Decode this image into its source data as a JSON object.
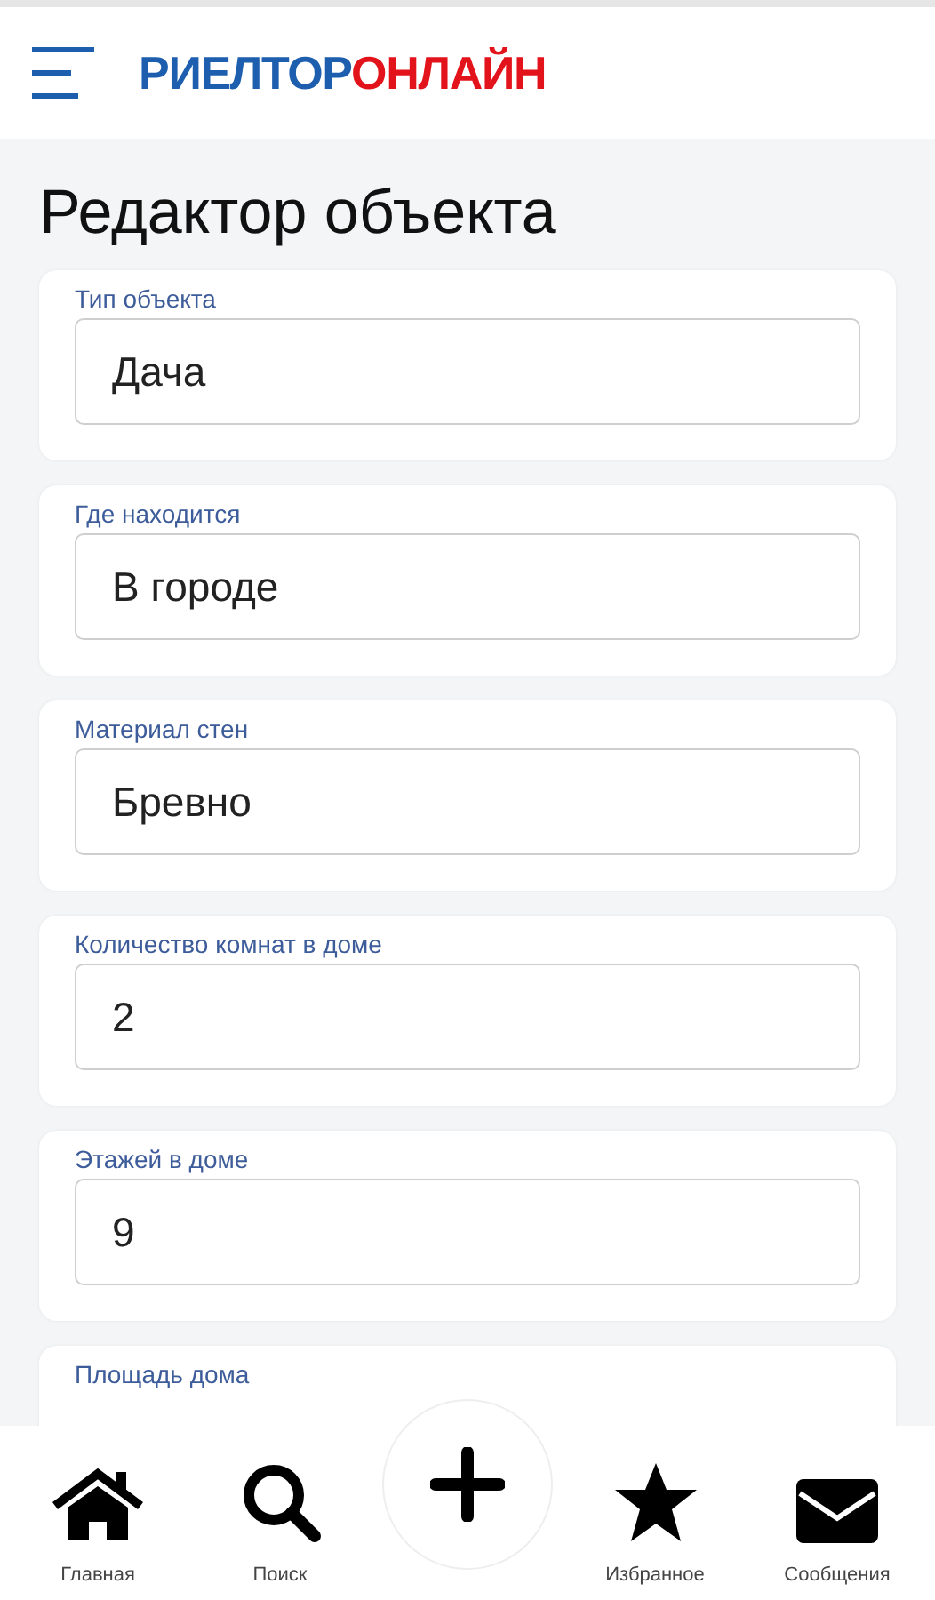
{
  "header": {
    "logo": [
      {
        "text": "РИЕЛТОР",
        "color": "#1d5fae"
      },
      {
        "text": "ОНЛАЙН",
        "color": "#e3131b"
      }
    ]
  },
  "title": "Редактор объекта",
  "fields": [
    {
      "label": "Тип объекта",
      "value": "Дача"
    },
    {
      "label": "Где находится",
      "value": "В городе"
    },
    {
      "label": "Материал стен",
      "value": "Бревно"
    },
    {
      "label": "Количество комнат в доме",
      "value": "2"
    },
    {
      "label": "Этажей в доме",
      "value": "9"
    },
    {
      "label": "Площадь дома"
    }
  ],
  "nav": [
    {
      "kind": "home",
      "label": "Главная"
    },
    {
      "kind": "search",
      "label": "Поиск"
    },
    {
      "kind": "add"
    },
    {
      "kind": "star",
      "label": "Избранное"
    },
    {
      "kind": "mail",
      "label": "Сообщения"
    }
  ]
}
